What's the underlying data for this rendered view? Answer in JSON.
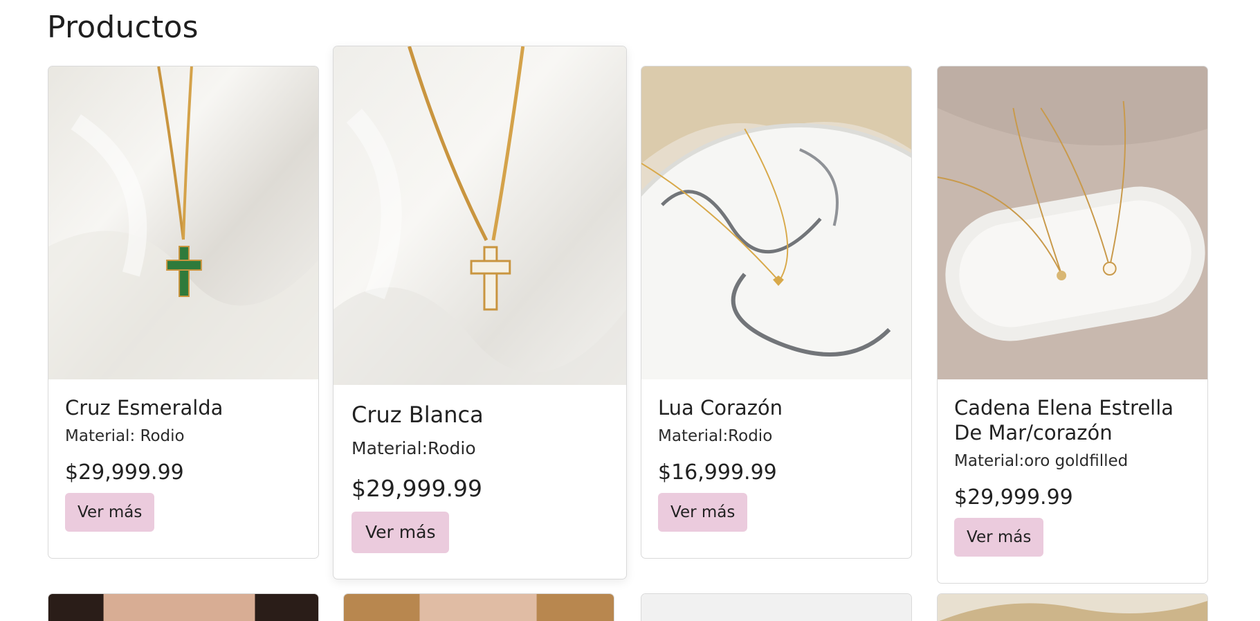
{
  "page": {
    "title": "Productos"
  },
  "products": [
    {
      "name": "Cruz Esmeralda",
      "material": "Material: Rodio",
      "price": "$29,999.99",
      "button": "Ver más",
      "image": "gold-chain-green-cross-on-white-satin"
    },
    {
      "name": "Cruz Blanca",
      "material": "Material:Rodio",
      "price": "$29,999.99",
      "button": "Ver más",
      "image": "gold-chain-white-stone-cross-on-white-satin"
    },
    {
      "name": "Lua Corazón",
      "material": "Material:Rodio",
      "price": "$16,999.99",
      "button": "Ver más",
      "image": "gold-heart-necklace-on-marble-plate"
    },
    {
      "name": "Cadena Elena Estrella De Mar/corazón",
      "material": "Material:oro goldfilled",
      "price": "$29,999.99",
      "button": "Ver más",
      "image": "two-gold-necklaces-on-white-tray"
    }
  ],
  "next_row_images": [
    "model-portrait",
    "model-portrait",
    "white-fabric",
    "pampas-grass"
  ],
  "colors": {
    "button_bg": "#ebcbdd",
    "border": "#d9d9d9",
    "text": "#222222"
  }
}
